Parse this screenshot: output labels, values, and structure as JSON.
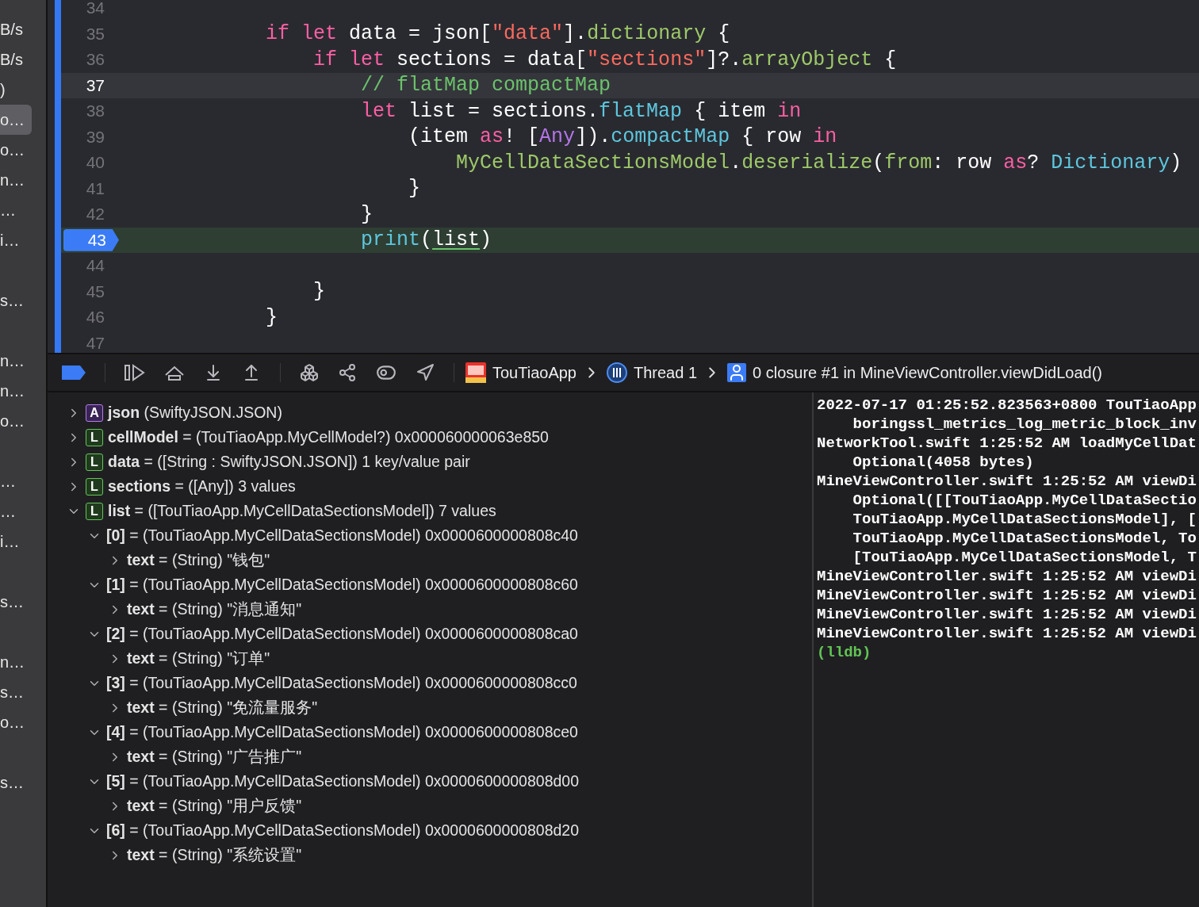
{
  "sidebar": {
    "groups": [
      {
        "items": [
          {
            "text": "B/s",
            "selected": false
          },
          {
            "text": "B/s",
            "selected": false
          },
          {
            "text": ")",
            "selected": false
          },
          {
            "text": "o…",
            "selected": true
          },
          {
            "text": "o…",
            "selected": false
          },
          {
            "text": "n…",
            "selected": false
          },
          {
            "text": "…",
            "selected": false
          },
          {
            "text": "i…",
            "selected": false
          }
        ]
      },
      {
        "items": [
          {
            "text": "s…",
            "selected": false
          }
        ]
      },
      {
        "items": [
          {
            "text": "n…",
            "selected": false
          },
          {
            "text": "n…",
            "selected": false
          },
          {
            "text": "o…",
            "selected": false
          }
        ]
      },
      {
        "items": [
          {
            "text": "…",
            "selected": false
          },
          {
            "text": "…",
            "selected": false
          },
          {
            "text": "i…",
            "selected": false
          }
        ]
      },
      {
        "items": [
          {
            "text": "s…",
            "selected": false
          }
        ]
      },
      {
        "items": [
          {
            "text": "n…",
            "selected": false
          },
          {
            "text": "s…",
            "selected": false
          },
          {
            "text": "o…",
            "selected": false
          }
        ]
      },
      {
        "items": [
          {
            "text": "s…",
            "selected": false
          }
        ]
      }
    ]
  },
  "editor": {
    "lines": [
      {
        "number": "34",
        "cursor": false,
        "breakpoint": false
      },
      {
        "number": "35",
        "cursor": false,
        "breakpoint": false,
        "tokens": [
          {
            "t": "            if let",
            "kind": "kw"
          },
          {
            "t": " data = json[",
            "kind": "plain"
          },
          {
            "t": "\"data\"",
            "kind": "str"
          },
          {
            "t": "].",
            "kind": "plain"
          },
          {
            "t": "dictionary",
            "kind": "member"
          },
          {
            "t": " {",
            "kind": "plain"
          }
        ]
      },
      {
        "number": "36",
        "cursor": false,
        "breakpoint": false,
        "tokens": [
          {
            "t": "                if let",
            "kind": "kw"
          },
          {
            "t": " sections = data[",
            "kind": "plain"
          },
          {
            "t": "\"sections\"",
            "kind": "str"
          },
          {
            "t": "]?.",
            "kind": "plain"
          },
          {
            "t": "arrayObject",
            "kind": "member"
          },
          {
            "t": " {",
            "kind": "plain"
          }
        ]
      },
      {
        "number": "37",
        "cursor": true,
        "breakpoint": false,
        "tokens": [
          {
            "t": "                    // flatMap compactMap",
            "kind": "comment"
          }
        ]
      },
      {
        "number": "38",
        "cursor": false,
        "breakpoint": false,
        "tokens": [
          {
            "t": "                    let",
            "kind": "kw"
          },
          {
            "t": " list = sections.",
            "kind": "plain"
          },
          {
            "t": "flatMap",
            "kind": "system"
          },
          {
            "t": " { item ",
            "kind": "plain"
          },
          {
            "t": "in",
            "kind": "kw"
          }
        ]
      },
      {
        "number": "39",
        "cursor": false,
        "breakpoint": false,
        "tokens": [
          {
            "t": "                        (item ",
            "kind": "plain"
          },
          {
            "t": "as",
            "kind": "kw"
          },
          {
            "t": "! [",
            "kind": "plain"
          },
          {
            "t": "Any",
            "kind": "type"
          },
          {
            "t": "]).",
            "kind": "plain"
          },
          {
            "t": "compactMap",
            "kind": "system"
          },
          {
            "t": " { row ",
            "kind": "plain"
          },
          {
            "t": "in",
            "kind": "kw"
          }
        ]
      },
      {
        "number": "40",
        "cursor": false,
        "breakpoint": false,
        "tokens": [
          {
            "t": "                            MyCellDataSectionsModel",
            "kind": "member"
          },
          {
            "t": ".",
            "kind": "plain"
          },
          {
            "t": "deserialize",
            "kind": "member"
          },
          {
            "t": "(",
            "kind": "plain"
          },
          {
            "t": "from",
            "kind": "member"
          },
          {
            "t": ": row ",
            "kind": "plain"
          },
          {
            "t": "as",
            "kind": "kw"
          },
          {
            "t": "? ",
            "kind": "plain"
          },
          {
            "t": "Dictionary",
            "kind": "system"
          },
          {
            "t": ")",
            "kind": "plain"
          }
        ]
      },
      {
        "number": "41",
        "cursor": false,
        "breakpoint": false,
        "tokens": [
          {
            "t": "                        }",
            "kind": "plain"
          }
        ]
      },
      {
        "number": "42",
        "cursor": false,
        "breakpoint": false,
        "tokens": [
          {
            "t": "                    }",
            "kind": "plain"
          }
        ]
      },
      {
        "number": "43",
        "cursor": false,
        "breakpoint": true,
        "tokens": [
          {
            "t": "                    print",
            "kind": "system"
          },
          {
            "t": "(",
            "kind": "plain"
          },
          {
            "t": "list",
            "kind": "var"
          },
          {
            "t": ")",
            "kind": "plain"
          }
        ]
      },
      {
        "number": "44",
        "cursor": false,
        "breakpoint": false
      },
      {
        "number": "45",
        "cursor": false,
        "breakpoint": false,
        "tokens": [
          {
            "t": "                }",
            "kind": "plain"
          }
        ]
      },
      {
        "number": "46",
        "cursor": false,
        "breakpoint": false,
        "tokens": [
          {
            "t": "            }",
            "kind": "plain"
          }
        ]
      },
      {
        "number": "47",
        "cursor": false,
        "breakpoint": false
      }
    ]
  },
  "debug_bar": {
    "breakpoints_active": true,
    "breadcrumbs": [
      {
        "kind": "app",
        "label": "TouTiaoApp"
      },
      {
        "kind": "thread",
        "label": "Thread 1"
      },
      {
        "kind": "frame",
        "label": "0 closure #1 in MineViewController.viewDidLoad()"
      }
    ]
  },
  "variables": [
    {
      "badge": "A",
      "kind": "argument",
      "name": "json",
      "value": "(SwiftyJSON.JSON)",
      "expanded": false
    },
    {
      "badge": "L",
      "kind": "local",
      "name": "cellModel",
      "value": "= (TouTiaoApp.MyCellModel?) 0x000060000063e850",
      "expanded": false
    },
    {
      "badge": "L",
      "kind": "local",
      "name": "data",
      "value": "= ([String : SwiftyJSON.JSON]) 1 key/value pair",
      "expanded": false
    },
    {
      "badge": "L",
      "kind": "local",
      "name": "sections",
      "value": "= ([Any]) 3 values",
      "expanded": false
    },
    {
      "badge": "L",
      "kind": "local",
      "name": "list",
      "value": "= ([TouTiaoApp.MyCellDataSectionsModel]) 7 values",
      "expanded": true,
      "children": [
        {
          "name": "[0]",
          "value": "= (TouTiaoApp.MyCellDataSectionsModel) 0x0000600000808c40",
          "expanded": true,
          "children": [
            {
              "name": "text",
              "value": "= (String) \"钱包\"",
              "expanded": false
            }
          ]
        },
        {
          "name": "[1]",
          "value": "= (TouTiaoApp.MyCellDataSectionsModel) 0x0000600000808c60",
          "expanded": true,
          "children": [
            {
              "name": "text",
              "value": "= (String) \"消息通知\"",
              "expanded": false
            }
          ]
        },
        {
          "name": "[2]",
          "value": "= (TouTiaoApp.MyCellDataSectionsModel) 0x0000600000808ca0",
          "expanded": true,
          "children": [
            {
              "name": "text",
              "value": "= (String) \"订单\"",
              "expanded": false
            }
          ]
        },
        {
          "name": "[3]",
          "value": "= (TouTiaoApp.MyCellDataSectionsModel) 0x0000600000808cc0",
          "expanded": true,
          "children": [
            {
              "name": "text",
              "value": "= (String) \"免流量服务\"",
              "expanded": false
            }
          ]
        },
        {
          "name": "[4]",
          "value": "= (TouTiaoApp.MyCellDataSectionsModel) 0x0000600000808ce0",
          "expanded": true,
          "children": [
            {
              "name": "text",
              "value": "= (String) \"广告推广\"",
              "expanded": false
            }
          ]
        },
        {
          "name": "[5]",
          "value": "= (TouTiaoApp.MyCellDataSectionsModel) 0x0000600000808d00",
          "expanded": true,
          "children": [
            {
              "name": "text",
              "value": "= (String) \"用户反馈\"",
              "expanded": false
            }
          ]
        },
        {
          "name": "[6]",
          "value": "= (TouTiaoApp.MyCellDataSectionsModel) 0x0000600000808d20",
          "expanded": true,
          "children": [
            {
              "name": "text",
              "value": "= (String) \"系统设置\"",
              "expanded": false
            }
          ]
        }
      ]
    }
  ],
  "console": [
    {
      "kind": "log",
      "text": "2022-07-17 01:25:52.823563+0800 TouTiaoApp"
    },
    {
      "kind": "log",
      "text": "    boringssl_metrics_log_metric_block_inv"
    },
    {
      "kind": "log",
      "text": "NetworkTool.swift 1:25:52 AM loadMyCellDat"
    },
    {
      "kind": "log",
      "text": "    Optional(4058 bytes)"
    },
    {
      "kind": "log",
      "text": "MineViewController.swift 1:25:52 AM viewDi"
    },
    {
      "kind": "log",
      "text": "    Optional([[TouTiaoApp.MyCellDataSectio"
    },
    {
      "kind": "log",
      "text": "    TouTiaoApp.MyCellDataSectionsModel], ["
    },
    {
      "kind": "log",
      "text": "    TouTiaoApp.MyCellDataSectionsModel, To"
    },
    {
      "kind": "log",
      "text": "    [TouTiaoApp.MyCellDataSectionsModel, T"
    },
    {
      "kind": "log",
      "text": "MineViewController.swift 1:25:52 AM viewDi"
    },
    {
      "kind": "log",
      "text": "MineViewController.swift 1:25:52 AM viewDi"
    },
    {
      "kind": "log",
      "text": "MineViewController.swift 1:25:52 AM viewDi"
    },
    {
      "kind": "log",
      "text": "MineViewController.swift 1:25:52 AM viewDi"
    },
    {
      "kind": "prompt",
      "text": "(lldb)"
    }
  ]
}
